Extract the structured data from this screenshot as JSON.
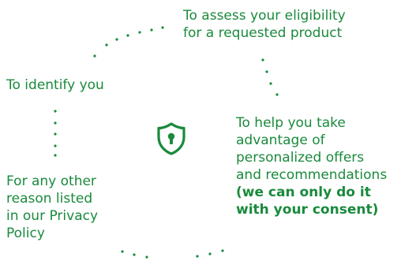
{
  "accent_color": "#1a8a3c",
  "center_icon": "shield-keyhole-icon",
  "purposes": {
    "assess": {
      "line1": "To assess your eligibility",
      "line2": "for a requested product"
    },
    "identify": {
      "line1": "To identify you"
    },
    "offers": {
      "line1": "To help you take",
      "line2": "advantage of",
      "line3": "personalized offers",
      "line4": "and recommendations",
      "consent1": "(we can only do it",
      "consent2": "with your consent)"
    },
    "other": {
      "line1": "For any other",
      "line2": "reason listed",
      "line3": "in our Privacy",
      "line4": "Policy"
    }
  }
}
